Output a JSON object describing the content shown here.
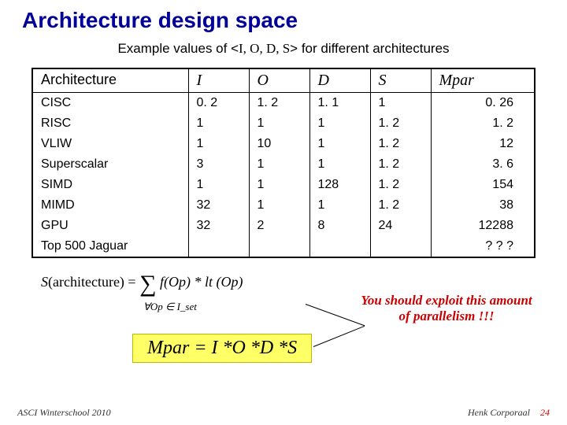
{
  "title": "Architecture design space",
  "subtitle_pre": "Example values of <",
  "subtitle_params": "I, O, D, S",
  "subtitle_post": "> for different architectures",
  "columns": {
    "arch": "Architecture",
    "I": "I",
    "O": "O",
    "D": "D",
    "S": "S",
    "Mpar": "Mpar"
  },
  "rows": [
    {
      "arch": "CISC",
      "I": "0. 2",
      "O": "1. 2",
      "D": "1. 1",
      "S": "1",
      "Mpar": "0. 26"
    },
    {
      "arch": "RISC",
      "I": "1",
      "O": "1",
      "D": "1",
      "S": "1. 2",
      "Mpar": "1. 2"
    },
    {
      "arch": "VLIW",
      "I": "1",
      "O": "10",
      "D": "1",
      "S": "1. 2",
      "Mpar": "12"
    },
    {
      "arch": "Superscalar",
      "I": "3",
      "O": "1",
      "D": "1",
      "S": "1. 2",
      "Mpar": "3. 6"
    },
    {
      "arch": "SIMD",
      "I": "1",
      "O": "1",
      "D": "128",
      "S": "1. 2",
      "Mpar": "154"
    },
    {
      "arch": "MIMD",
      "I": "32",
      "O": "1",
      "D": "1",
      "S": "1. 2",
      "Mpar": "38"
    },
    {
      "arch": "GPU",
      "I": "32",
      "O": "2",
      "D": "8",
      "S": "24",
      "Mpar": "12288"
    },
    {
      "arch": "Top 500 Jaguar",
      "I": "",
      "O": "",
      "D": "",
      "S": "",
      "Mpar": "? ? ?"
    }
  ],
  "sformula": {
    "lhs": "S",
    "lhs_arg": "(architecture) = ",
    "sum": "∑",
    "rhs": " f(Op) * lt (Op)",
    "sub": "∀Op ∈ I_set"
  },
  "mpar_formula": "Mpar =  I *O *D *S",
  "callout": "You should exploit this amount of parallelism !!!",
  "footer": {
    "left": "ASCI Winterschool 2010",
    "right": "Henk Corporaal",
    "page": "24"
  }
}
